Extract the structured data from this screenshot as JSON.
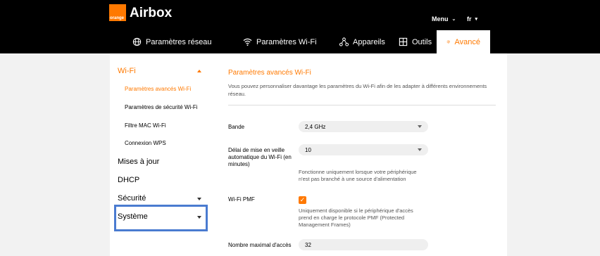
{
  "brand": {
    "logo_text": "orange",
    "title": "Airbox"
  },
  "top_menu": {
    "menu_label": "Menu",
    "lang_label": "fr"
  },
  "nav": {
    "tabs": [
      {
        "label": "Paramètres réseau",
        "icon": "globe-icon"
      },
      {
        "label": "Paramètres Wi-Fi",
        "icon": "wifi-icon"
      },
      {
        "label": "Appareils",
        "icon": "devices-icon"
      },
      {
        "label": "Outils",
        "icon": "tools-icon"
      },
      {
        "label": "Avancé",
        "icon": "gear-icon",
        "active": true
      }
    ]
  },
  "sidebar": {
    "wifi": {
      "label": "Wi-Fi",
      "subitems": [
        "Paramètres avancés Wi-Fi",
        "Paramètres de sécurité Wi-Fi",
        "Filtre MAC Wi-Fi",
        "Connexion WPS"
      ]
    },
    "items": [
      "Mises à jour",
      "DHCP",
      "Sécurité",
      "Système"
    ]
  },
  "main": {
    "title": "Paramètres avancés Wi-Fi",
    "description": "Vous pouvez personnaliser davantage les paramètres du Wi-Fi afin de les adapter à différents environnements réseau.",
    "fields": {
      "band": {
        "label": "Bande",
        "value": "2,4 GHz"
      },
      "sleep": {
        "label": "Délai de mise en veille automatique du Wi-Fi (en minutes)",
        "value": "10",
        "hint": "Fonctionne uniquement lorsque votre périphérique n'est pas branché à une source d'alimentation"
      },
      "pmf": {
        "label": "Wi-Fi PMF",
        "checked": true,
        "hint": "Uniquement disponible si le périphérique d'accès prend en charge le protocole PMF (Protected Management Frames)"
      },
      "max_access": {
        "label": "Nombre maximal d'accès",
        "value": "32"
      }
    }
  },
  "colors": {
    "accent": "#ff7900",
    "highlight": "#4a7bd0"
  }
}
